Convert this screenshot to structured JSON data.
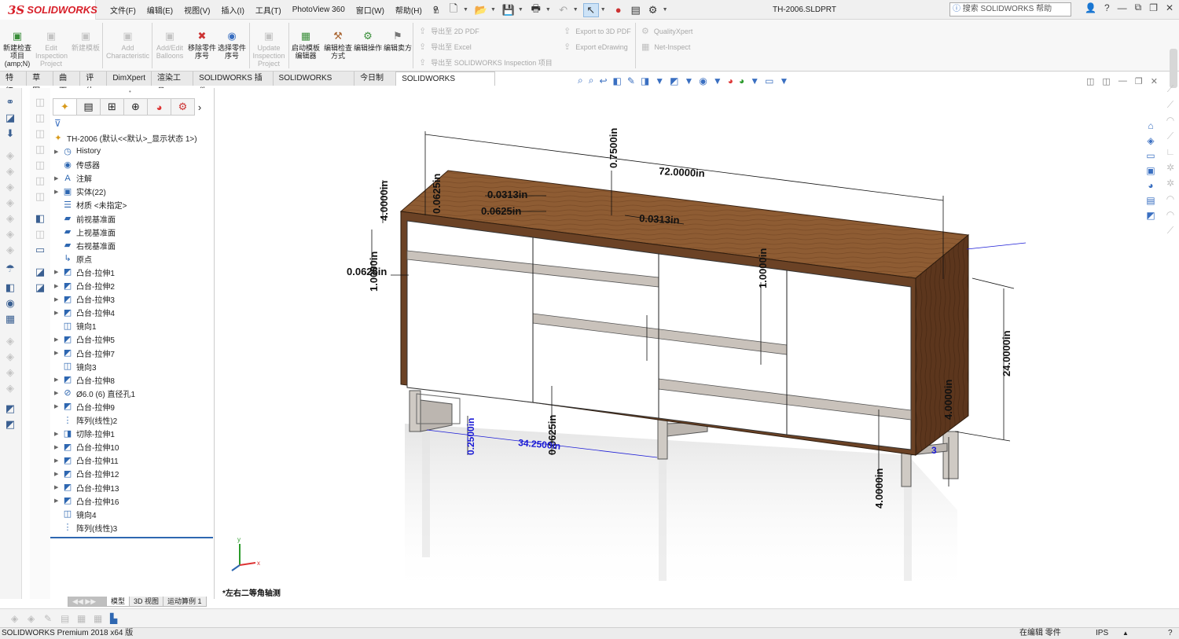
{
  "app": {
    "logo_prefix": "3S",
    "logo_text": "SOLIDWORKS",
    "document_title": "TH-2006.SLDPRT",
    "search_placeholder": "搜索 SOLIDWORKS 帮助"
  },
  "menu": [
    "文件(F)",
    "编辑(E)",
    "视图(V)",
    "插入(I)",
    "工具(T)",
    "PhotoView 360",
    "窗口(W)",
    "帮助(H)"
  ],
  "commands": [
    {
      "label": "新建检查项目 (amp;N)",
      "icon": "new-inspection-icon",
      "enabled": true
    },
    {
      "label": "Edit Inspection Project",
      "icon": "edit-inspection-icon",
      "enabled": false
    },
    {
      "label": "新建模板",
      "icon": "new-template-icon",
      "enabled": false
    },
    {
      "label": "Add Characteristic",
      "icon": "add-characteristic-icon",
      "enabled": false
    },
    {
      "label": "Add/Edit Balloons",
      "icon": "balloons-icon",
      "enabled": false
    },
    {
      "label": "移除零件序号",
      "icon": "remove-balloon-icon",
      "enabled": true
    },
    {
      "label": "选择零件序号",
      "icon": "select-balloon-icon",
      "enabled": true
    },
    {
      "label": "Update Inspection Project",
      "icon": "update-inspection-icon",
      "enabled": false
    },
    {
      "label": "启动模板编辑器",
      "icon": "template-editor-icon",
      "enabled": true
    },
    {
      "label": "编辑检查方式",
      "icon": "edit-method-icon",
      "enabled": true
    },
    {
      "label": "编辑操作",
      "icon": "edit-operation-icon",
      "enabled": true
    },
    {
      "label": "编辑卖方",
      "icon": "edit-vendor-icon",
      "enabled": true
    }
  ],
  "export_commands": {
    "col1": [
      "导出至 2D PDF",
      "导出至 Excel",
      "导出至 SOLIDWORKS Inspection 项目"
    ],
    "col2": [
      "Export to 3D PDF",
      "Export eDrawing"
    ],
    "col3": [
      "QualityXpert",
      "Net-Inspect"
    ]
  },
  "tabs": [
    "特征",
    "草图",
    "曲面",
    "评估",
    "DimXpert",
    "渲染工具",
    "SOLIDWORKS 插件",
    "SOLIDWORKS MBD",
    "今日制造",
    "SOLIDWORKS Inspection"
  ],
  "active_tab": "SOLIDWORKS Inspection",
  "tree": {
    "root": "TH-2006  (默认<<默认>_显示状态 1>)",
    "items": [
      {
        "label": "History",
        "icon": "history-icon",
        "expandable": true
      },
      {
        "label": "传感器",
        "icon": "sensor-icon",
        "expandable": false
      },
      {
        "label": "注解",
        "icon": "annotation-icon",
        "expandable": true
      },
      {
        "label": "实体(22)",
        "icon": "solid-bodies-icon",
        "expandable": true
      },
      {
        "label": "材质 <未指定>",
        "icon": "material-icon",
        "expandable": false
      },
      {
        "label": "前视基准面",
        "icon": "plane-icon",
        "expandable": false
      },
      {
        "label": "上视基准面",
        "icon": "plane-icon",
        "expandable": false
      },
      {
        "label": "右视基准面",
        "icon": "plane-icon",
        "expandable": false
      },
      {
        "label": "原点",
        "icon": "origin-icon",
        "expandable": false
      },
      {
        "label": "凸台-拉伸1",
        "icon": "extrude-icon",
        "expandable": true
      },
      {
        "label": "凸台-拉伸2",
        "icon": "extrude-icon",
        "expandable": true
      },
      {
        "label": "凸台-拉伸3",
        "icon": "extrude-icon",
        "expandable": true
      },
      {
        "label": "凸台-拉伸4",
        "icon": "extrude-icon",
        "expandable": true
      },
      {
        "label": "镜向1",
        "icon": "mirror-icon",
        "expandable": false
      },
      {
        "label": "凸台-拉伸5",
        "icon": "extrude-icon",
        "expandable": true
      },
      {
        "label": "凸台-拉伸7",
        "icon": "extrude-icon",
        "expandable": true
      },
      {
        "label": "镜向3",
        "icon": "mirror-icon",
        "expandable": false
      },
      {
        "label": "凸台-拉伸8",
        "icon": "extrude-icon",
        "expandable": true
      },
      {
        "label": "Ø6.0 (6) 直径孔1",
        "icon": "hole-icon",
        "expandable": true
      },
      {
        "label": "凸台-拉伸9",
        "icon": "extrude-icon",
        "expandable": true
      },
      {
        "label": "阵列(线性)2",
        "icon": "pattern-icon",
        "expandable": false
      },
      {
        "label": "切除-拉伸1",
        "icon": "cut-icon",
        "expandable": true
      },
      {
        "label": "凸台-拉伸10",
        "icon": "extrude-icon",
        "expandable": true
      },
      {
        "label": "凸台-拉伸11",
        "icon": "extrude-icon",
        "expandable": true
      },
      {
        "label": "凸台-拉伸12",
        "icon": "extrude-icon",
        "expandable": true
      },
      {
        "label": "凸台-拉伸13",
        "icon": "extrude-icon",
        "expandable": true
      },
      {
        "label": "凸台-拉伸16",
        "icon": "extrude-icon",
        "expandable": true
      },
      {
        "label": "镜向4",
        "icon": "mirror-icon",
        "expandable": false
      },
      {
        "label": "阵列(线性)3",
        "icon": "pattern-icon",
        "expandable": false
      }
    ]
  },
  "dimensions": {
    "overall_width": "72.0000in",
    "height": "24.0000in",
    "top_offset": "0.7500in",
    "top_thickness": "0.0625in",
    "dim_4_top": "4.0000in",
    "dim_0313_left": "0.0313in",
    "dim_0625_left": "0.0625in",
    "dim_0313_mid": "0.0313in",
    "dim_0625_side": "0.0625in",
    "dim_1_left": "1.0000in",
    "dim_1_mid": "1.0000in",
    "bay_width": "34.2500in",
    "leg_offset": "0.2500in",
    "foot_dim": "0.0625in",
    "dim_4_bottom": "4.0000in",
    "dim_4_right": "4.0000in",
    "corner_label": "3"
  },
  "viewport": {
    "view_name": "*左右二等角轴测"
  },
  "bottom_tabs": [
    "模型",
    "3D 视图",
    "运动算例 1"
  ],
  "active_bottom_tab": "模型",
  "status": {
    "app_version": "SOLIDWORKS Premium 2018 x64 版",
    "mode": "在编辑 零件",
    "units": "IPS"
  },
  "colors": {
    "wood_top": "#8a5a32",
    "wood_side": "#5a341c",
    "dimension_text": "#111111",
    "driven_dimension": "#1b1bd6",
    "accent": "#2e67b1",
    "brand_red": "#d8202a"
  }
}
